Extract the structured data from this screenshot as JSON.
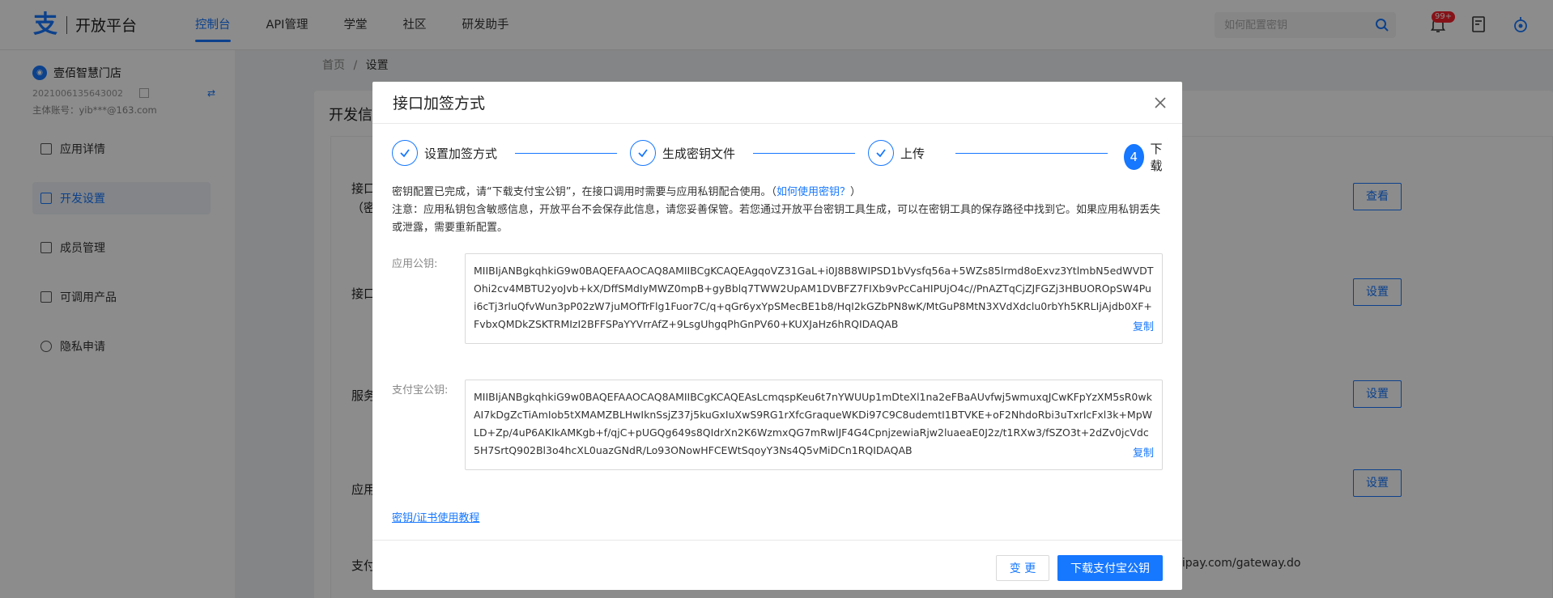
{
  "header": {
    "logo_text": "开放平台",
    "tabs": [
      {
        "label": "控制台",
        "active": true
      },
      {
        "label": "API管理"
      },
      {
        "label": "学堂"
      },
      {
        "label": "社区"
      },
      {
        "label": "研发助手"
      }
    ],
    "search_placeholder": "如何配置密钥",
    "notification_badge": "99+"
  },
  "sidebar": {
    "account_name": "壹佰智慧门店",
    "account_id": "2021006135643002",
    "main_account": "主体账号：yib***@163.com",
    "items": [
      {
        "label": "应用详情"
      },
      {
        "label": "开发设置",
        "active": true
      },
      {
        "label": "成员管理"
      },
      {
        "label": "可调用产品"
      },
      {
        "label": "隐私申请"
      }
    ]
  },
  "breadcrumb": {
    "home": "首页",
    "sep": "/",
    "current": "设置"
  },
  "main": {
    "card_title": "开发信",
    "rows": [
      {
        "label": "接口",
        "sub": "（密"
      },
      {
        "label": "接口"
      },
      {
        "label": "服务"
      },
      {
        "label": "应用"
      },
      {
        "label": "支付"
      }
    ],
    "buttons": [
      "查看",
      "设置",
      "设置",
      "设置"
    ],
    "gateway_text": "lipay.com/gateway.do"
  },
  "modal": {
    "title": "接口加签方式",
    "steps": [
      {
        "label": "设置加签方式",
        "done": true
      },
      {
        "label": "生成密钥文件",
        "done": true
      },
      {
        "label": "上传",
        "done": true
      },
      {
        "label": "下载",
        "number": "4",
        "active": true
      }
    ],
    "notice_line1": "密钥配置已完成，请“下载支付宝公钥”，在接口调用时需要与应用私钥配合使用。",
    "notice_link": "如何使用密钥？",
    "notice_line1_end": "）",
    "notice_line1_open": "（",
    "notice_line2": "注意：应用私钥包含敏感信息，开放平台不会保存此信息，请您妥善保管。若您通过开放平台密钥工具生成，可以在密钥工具的保存路径中找到它。如果应用私钥丢失或泄露，需要重新配置。",
    "app_key_label": "应用公钥:",
    "app_key": "MIIBIjANBgkqhkiG9w0BAQEFAAOCAQ8AMIIBCgKCAQEAgqoVZ31GaL+i0J8B8WIPSD1bVysfq56a+5WZs85lrmd8oExvz3YtlmbN5edWVDTOhi2cv4MBTU2yoJvb+kX/DffSMdIyMWZ0mpB+gyBblq7TWW2UpAM1DVBFZ7FIXb9vPcCaHIPUjO4c//PnAZTqCjZJFGZj3HBUOROpSW4Pui6cTj3rluQfvWun3pP02zW7juMOfTrFlg1Fuor7C/q+qGr6yxYpSMecBE1b8/HqI2kGZbPN8wK/MtGuP8MtN3XVdXdclu0rbYh5KRLIjAjdb0XF+FvbxQMDkZSKTRMIzI2BFFSPaYYVrrAfZ+9LsgUhgqPhGnPV60+KUXJaHz6hRQIDAQAB",
    "alipay_key_label": "支付宝公钥:",
    "alipay_key": "MIIBIjANBgkqhkiG9w0BAQEFAAOCAQ8AMIIBCgKCAQEAsLcmqspKeu6t7nYWUUp1mDteXl1na2eFBaAUvfwj5wmuxqJCwKFpYzXM5sR0wkAI7kDgZcTiAmIob5tXMAMZBLHwIknSsjZ37j5kuGxIuXwS9RG1rXfcGraqueWKDi97C9C8udemtI1BTVKE+oF2NhdoRbi3uTxrlcFxl3k+MpWLD+Zp/4uP6AKIkAMKgb+f/qjC+pUGQg649s8QIdrXn2K6WzmxQG7mRwlJF4G4CpnjzewiaRjw2luaeaE0J2z/t1RXw3/fSZO3t+2dZv0jcVdc5H7SrtQ902Bl3o4hcXL0uazGNdR/Lo93ONowHFCEWtSqoyY3Ns4Q5vMiDCn1RQIDAQAB",
    "copy_label": "复制",
    "tutorial_link": "密钥/证书使用教程",
    "change_button": "变 更",
    "download_button": "下载支付宝公钥"
  },
  "colors": {
    "accent": "#1677ff",
    "overlay": "rgba(0,0,0,0.45)"
  }
}
